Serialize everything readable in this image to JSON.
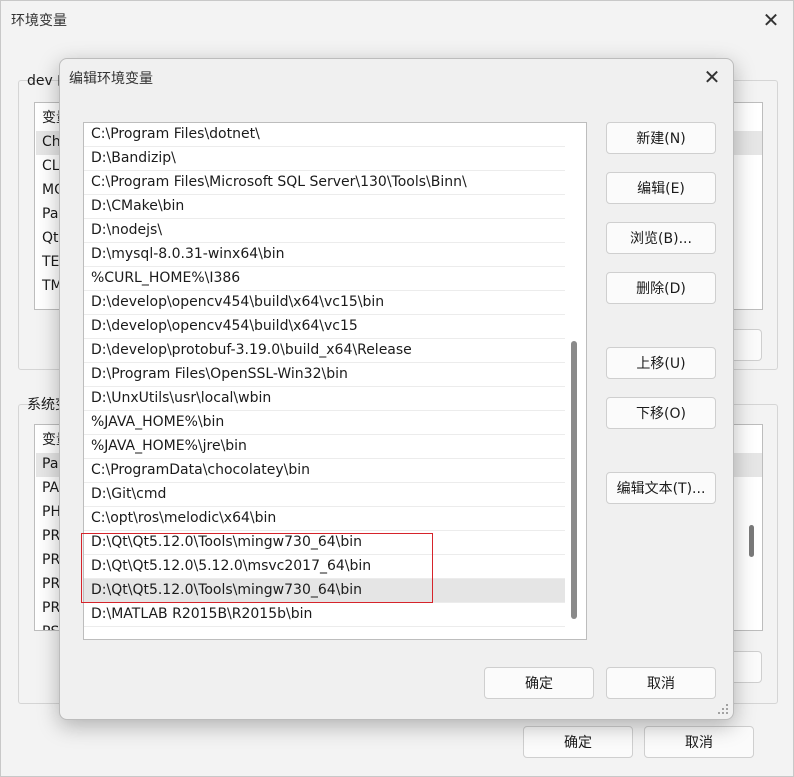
{
  "parent": {
    "title": "环境变量",
    "user_group_label": "dev 的",
    "user_list_peek": [
      "变量",
      "Ch",
      "CL",
      "MO",
      "Pa",
      "Qt",
      "TE",
      "TM"
    ],
    "system_group_label": "系统变",
    "system_list_peek": [
      "变量",
      "Pa",
      "PA",
      "PH",
      "PR",
      "PR",
      "PR",
      "PR",
      "PS"
    ],
    "ok_label": "确定",
    "cancel_label": "取消"
  },
  "dialog": {
    "title": "编辑环境变量",
    "paths": [
      "C:\\Program Files\\dotnet\\",
      "D:\\Bandizip\\",
      "C:\\Program Files\\Microsoft SQL Server\\130\\Tools\\Binn\\",
      "D:\\CMake\\bin",
      "D:\\nodejs\\",
      "D:\\mysql-8.0.31-winx64\\bin",
      "%CURL_HOME%\\I386",
      "D:\\develop\\opencv454\\build\\x64\\vc15\\bin",
      "D:\\develop\\opencv454\\build\\x64\\vc15",
      "D:\\develop\\protobuf-3.19.0\\build_x64\\Release",
      "D:\\Program Files\\OpenSSL-Win32\\bin",
      "D:\\UnxUtils\\usr\\local\\wbin",
      "%JAVA_HOME%\\bin",
      "%JAVA_HOME%\\jre\\bin",
      "C:\\ProgramData\\chocolatey\\bin",
      "D:\\Git\\cmd",
      "C:\\opt\\ros\\melodic\\x64\\bin",
      "D:\\Qt\\Qt5.12.0\\Tools\\mingw730_64\\bin",
      "D:\\Qt\\Qt5.12.0\\5.12.0\\msvc2017_64\\bin",
      "D:\\Qt\\Qt5.12.0\\Tools\\mingw730_64\\bin",
      "D:\\MATLAB R2015B\\R2015b\\bin"
    ],
    "selected_index": 19,
    "buttons": {
      "new": "新建(N)",
      "edit": "编辑(E)",
      "browse": "浏览(B)...",
      "delete": "删除(D)",
      "move_up": "上移(U)",
      "move_down": "下移(O)",
      "edit_text": "编辑文本(T)..."
    },
    "ok_label": "确定",
    "cancel_label": "取消"
  },
  "colors": {
    "highlight_border": "#d6242b",
    "selection_bg": "#e5e5e5"
  },
  "icons": {
    "close": "close-icon",
    "resize": "resize-grip-icon"
  }
}
